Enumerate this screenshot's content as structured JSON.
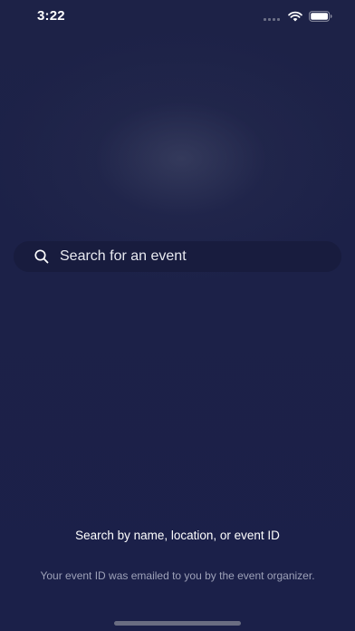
{
  "status_bar": {
    "time": "3:22",
    "icons": [
      "signal-icon",
      "wifi-icon",
      "battery-icon"
    ]
  },
  "search": {
    "placeholder": "Search for an event",
    "value": "",
    "icon": "search-icon"
  },
  "help": {
    "title": "Search by name, location, or event ID",
    "subtitle": "Your event ID was emailed to you by the event organizer."
  },
  "colors": {
    "background": "#1b2046",
    "search_field": "#181c3e",
    "text_primary": "#ffffff",
    "text_secondary": "#9da1b8"
  }
}
